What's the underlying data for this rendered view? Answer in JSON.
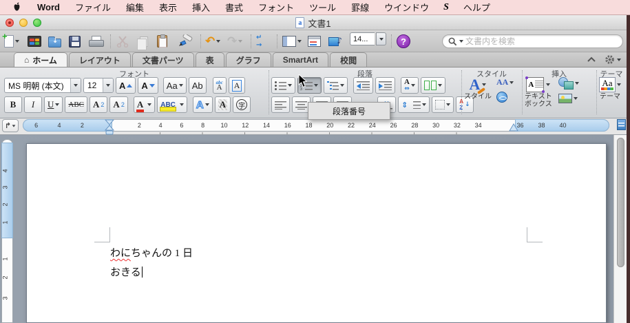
{
  "menu_bar": {
    "word": "Word",
    "items": [
      "ファイル",
      "編集",
      "表示",
      "挿入",
      "書式",
      "フォント",
      "ツール",
      "罫線",
      "ウインドウ"
    ],
    "script_glyph": "S",
    "help": "ヘルプ"
  },
  "title_bar": {
    "title": "文書1",
    "doc_icon_letter": "a"
  },
  "toolbar": {
    "undo_glyph": "↶",
    "redo_glyph": "↶",
    "marks_top": "↵",
    "marks_bottom": "→",
    "zoom_value": "14...",
    "help_glyph": "?",
    "search_placeholder": "文書内を検索"
  },
  "tab_bar": {
    "active": "ホーム",
    "home_glyph": "⌂",
    "others": [
      "レイアウト",
      "文書パーツ",
      "表",
      "グラフ",
      "SmartArt",
      "校閲"
    ]
  },
  "ribbon": {
    "font_group": {
      "label": "フォント",
      "font_name": "MS 明朝 (本文)",
      "font_size": "12",
      "grow": "A",
      "shrink": "A",
      "change_case": "Aa",
      "clear_format": "Ab",
      "ruby_top": "abc",
      "ruby_bottom": "A",
      "char_border": "A",
      "bold": "B",
      "italic": "I",
      "underline": "U",
      "strikethrough": "ABC",
      "superscript_base": "A",
      "superscript_mark": "2",
      "subscript_base": "A",
      "subscript_mark": "2",
      "font_color": "A",
      "highlight": "ABC",
      "text_effects": "A",
      "char_shading": "A",
      "enclose": "字"
    },
    "paragraph_group": {
      "label": "段落",
      "spacing_letter": "A",
      "spacing_arrows": "⇔",
      "distribute_arrows": "⇔",
      "linespace_arrows": "⇕",
      "sort_a": "A",
      "sort_z": "Z",
      "sort_arrow": "↓"
    },
    "style_group": {
      "label": "スタイル",
      "style_big": "A",
      "style_caption": "スタイル",
      "quick_aa": "AA"
    },
    "insert_group": {
      "label": "挿入",
      "textbox_letter": "A",
      "caption_line1": "テキスト",
      "caption_line2": "ボックス"
    },
    "theme_group": {
      "label": "テーマ",
      "icon_text": "Aa",
      "caption": "テーマ"
    },
    "tooltip": "段落番号"
  },
  "ruler": {
    "left_margin_numbers": [
      "6",
      "4",
      "2"
    ],
    "body_numbers": [
      "2",
      "4",
      "6",
      "8",
      "10",
      "12",
      "14",
      "16",
      "18",
      "20",
      "22",
      "24",
      "26",
      "28",
      "30",
      "32",
      "34"
    ],
    "right_margin_numbers": [
      "36",
      "38",
      "40"
    ],
    "v_margin_numbers": [
      "4",
      "3",
      "2",
      "1"
    ],
    "v_body_numbers": [
      "1",
      "2",
      "3"
    ],
    "tab_selector_glyph": "↱"
  },
  "document": {
    "line1_misspelled": "わに",
    "line1_rest": "ちゃんの 1 日",
    "line2": "おきる"
  },
  "colors": {
    "menu_bar_bg": "#f8dcdc",
    "desktop_edge": "#472c2c",
    "ruler_margin_blue": "#b9d7f1",
    "accent_blue": "#3a7bd5"
  }
}
